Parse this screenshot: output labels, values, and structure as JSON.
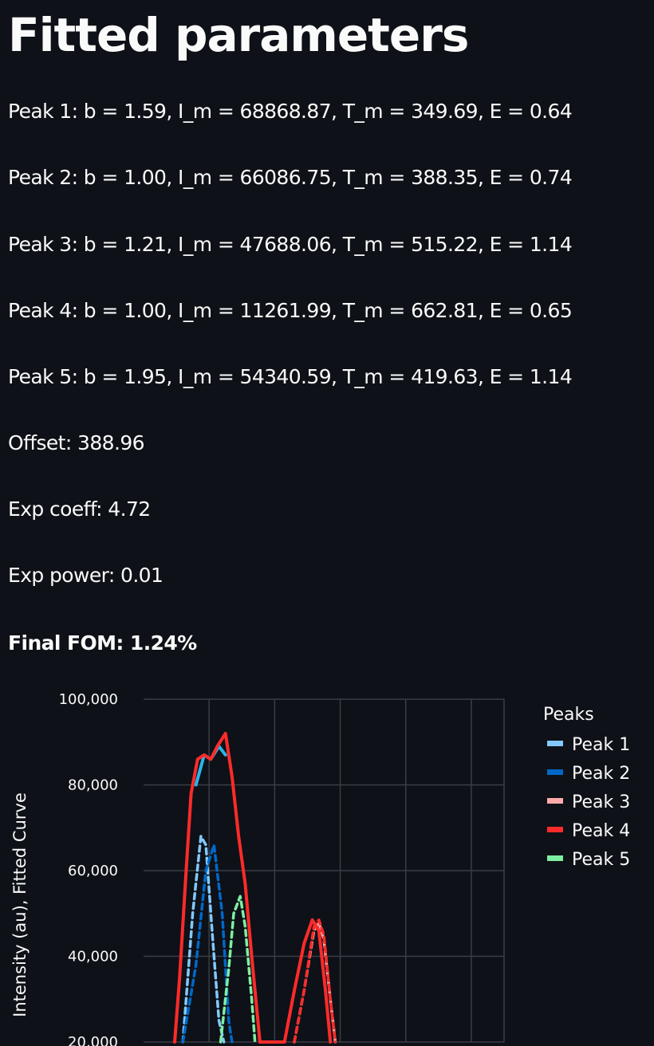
{
  "page": {
    "title": "Fitted parameters"
  },
  "params": [
    "Peak 1: b = 1.59, I_m = 68868.87, T_m = 349.69, E = 0.64",
    "Peak 2: b = 1.00, I_m = 66086.75, T_m = 388.35, E = 0.74",
    "Peak 3: b = 1.21, I_m = 47688.06, T_m = 515.22, E = 1.14",
    "Peak 4: b = 1.00, I_m = 11261.99, T_m = 662.81, E = 0.65",
    "Peak 5: b = 1.95, I_m = 54340.59, T_m = 419.63, E = 1.14",
    "Offset: 388.96",
    "Exp coeff: 4.72",
    "Exp power: 0.01"
  ],
  "fom": "Final FOM: 1.24%",
  "colors": {
    "background": "#0e1117",
    "grid": "#3a3d45",
    "peak1": "#83c9ff",
    "peak2": "#0068c9",
    "peak3": "#ffabab",
    "peak4": "#ff2b2b",
    "peak5": "#7defa1",
    "fitted": "#ff2b2b",
    "measured": "#29b5e8"
  },
  "chart_data": {
    "type": "line",
    "ylabel": "Intensity (au), Fitted Curve",
    "ytick_labels": [
      "100,000",
      "80,000",
      "60,000",
      "40,000",
      "20,000"
    ],
    "yticks": [
      100000,
      80000,
      60000,
      40000,
      20000
    ],
    "ylim": [
      20000,
      100000
    ],
    "xlim": [
      0,
      11
    ],
    "grid": true,
    "legend": {
      "title": "Peaks",
      "placement": "right",
      "entries": [
        "Peak 1",
        "Peak 2",
        "Peak 3",
        "Peak 4",
        "Peak 5"
      ]
    },
    "series": [
      {
        "name": "Peak 1",
        "dash": true,
        "values": [
          [
            1.2,
            20000
          ],
          [
            1.5,
            50000
          ],
          [
            1.75,
            68000
          ],
          [
            1.9,
            66000
          ],
          [
            2.1,
            45000
          ],
          [
            2.3,
            25000
          ],
          [
            2.45,
            20000
          ]
        ]
      },
      {
        "name": "Peak 2",
        "dash": true,
        "values": [
          [
            1.2,
            20000
          ],
          [
            1.6,
            38000
          ],
          [
            1.9,
            60000
          ],
          [
            2.15,
            66000
          ],
          [
            2.4,
            50000
          ],
          [
            2.6,
            25000
          ],
          [
            2.7,
            20000
          ]
        ]
      },
      {
        "name": "Peak 5",
        "dash": true,
        "values": [
          [
            2.35,
            20000
          ],
          [
            2.6,
            37000
          ],
          [
            2.75,
            50000
          ],
          [
            2.95,
            54000
          ],
          [
            3.1,
            47000
          ],
          [
            3.3,
            30000
          ],
          [
            3.4,
            20000
          ]
        ]
      },
      {
        "name": "Peak 3",
        "dash": true,
        "values": [
          [
            4.6,
            20000
          ],
          [
            4.9,
            32000
          ],
          [
            5.2,
            46000
          ],
          [
            5.35,
            48000
          ],
          [
            5.5,
            44000
          ],
          [
            5.7,
            30000
          ],
          [
            5.85,
            20000
          ]
        ]
      },
      {
        "name": "Peak 4",
        "dash": true,
        "values": [
          [
            4.6,
            20000
          ],
          [
            4.9,
            32000
          ],
          [
            5.2,
            47000
          ],
          [
            5.35,
            48500
          ],
          [
            5.5,
            45000
          ],
          [
            5.7,
            30000
          ],
          [
            5.85,
            20000
          ]
        ]
      },
      {
        "name": "",
        "values": [
          [
            1.6,
            80000
          ],
          [
            1.85,
            87000
          ],
          [
            2.05,
            86000
          ],
          [
            2.3,
            89000
          ],
          [
            2.5,
            87000
          ]
        ]
      },
      {
        "name": "",
        "values": [
          [
            0.95,
            20000
          ],
          [
            1.1,
            35000
          ],
          [
            1.3,
            60000
          ],
          [
            1.45,
            78000
          ],
          [
            1.65,
            86000
          ],
          [
            1.85,
            87000
          ],
          [
            2.05,
            86000
          ],
          [
            2.25,
            89000
          ],
          [
            2.5,
            92000
          ],
          [
            2.7,
            82000
          ],
          [
            2.9,
            68000
          ],
          [
            3.1,
            57000
          ],
          [
            3.3,
            40000
          ],
          [
            3.55,
            20000
          ],
          [
            4.3,
            20000
          ],
          [
            4.6,
            32000
          ],
          [
            4.9,
            43000
          ],
          [
            5.15,
            48500
          ],
          [
            5.35,
            46000
          ],
          [
            5.55,
            32000
          ],
          [
            5.7,
            20000
          ]
        ]
      }
    ]
  }
}
